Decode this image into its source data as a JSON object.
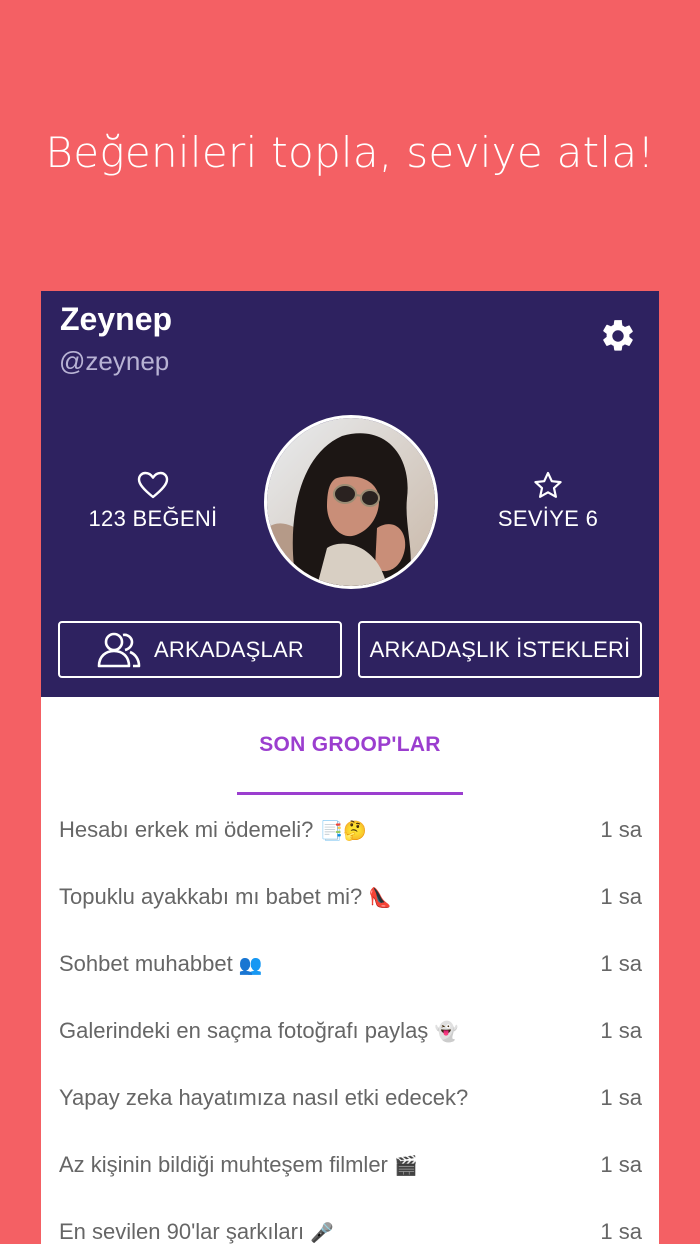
{
  "headline": "Beğenileri topla, seviye atla!",
  "profile": {
    "name": "Zeynep",
    "handle": "@zeynep",
    "likes_label": "123 BEĞENİ",
    "level_label": "SEVİYE 6",
    "friends_button": "ARKADAŞLAR",
    "requests_button": "ARKADAŞLIK İSTEKLERİ"
  },
  "tab": {
    "label": "SON GROOP'LAR"
  },
  "groups": [
    {
      "title": "Hesabı erkek mi ödemeli?",
      "emoji": "📑🤔",
      "time": "1 sa"
    },
    {
      "title": "Topuklu ayakkabı mı babet mi?",
      "emoji": "👠",
      "time": "1 sa"
    },
    {
      "title": "Sohbet muhabbet",
      "emoji": "👥",
      "time": "1 sa"
    },
    {
      "title": "Galerindeki en saçma fotoğrafı paylaş",
      "emoji": "👻",
      "time": "1 sa"
    },
    {
      "title": "Yapay zeka hayatımıza nasıl etki edecek?",
      "emoji": "",
      "time": "1 sa"
    },
    {
      "title": "Az kişinin bildiği muhteşem filmler",
      "emoji": "🎬",
      "time": "1 sa"
    },
    {
      "title": "En sevilen 90'lar şarkıları",
      "emoji": "🎤",
      "time": "1 sa"
    }
  ],
  "colors": {
    "background": "#f46064",
    "header": "#2e2260",
    "accent": "#9b3ecf"
  },
  "icons": {
    "settings": "gear-icon",
    "likes": "heart-icon",
    "level": "star-icon",
    "friends": "people-icon"
  }
}
